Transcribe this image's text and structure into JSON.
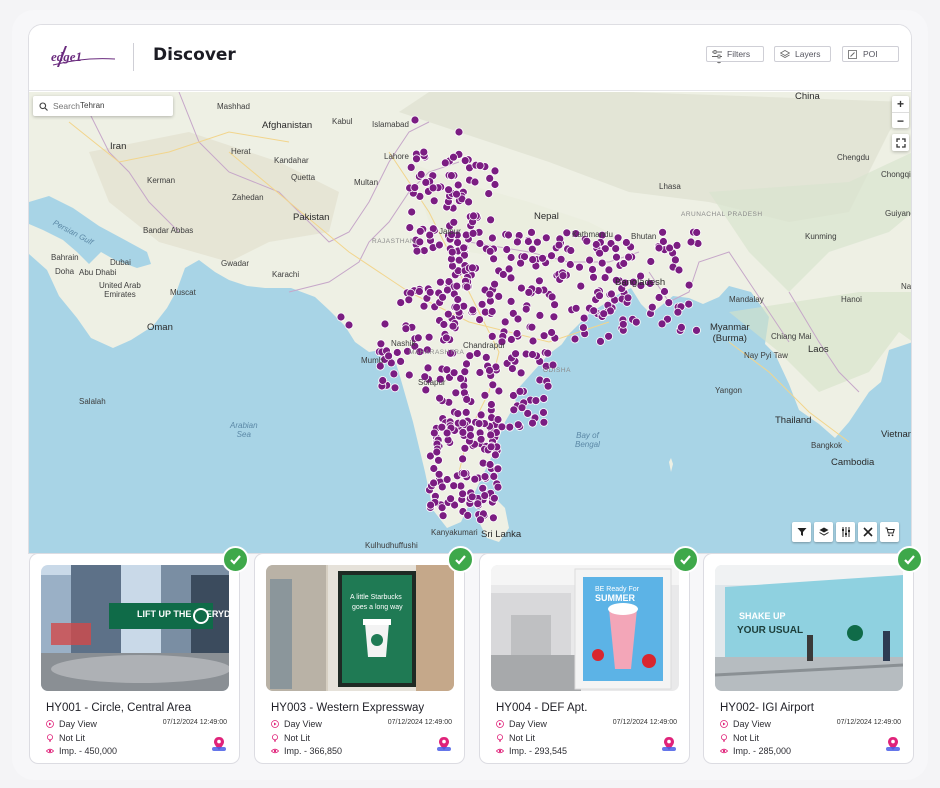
{
  "header": {
    "logo_text": "edge1",
    "title": "Discover",
    "buttons": [
      {
        "label": "Filters",
        "icon": "sliders-icon"
      },
      {
        "label": "Layers",
        "icon": "layers-icon"
      },
      {
        "label": "POI",
        "icon": "pencil-icon"
      }
    ]
  },
  "map": {
    "search_placeholder": "Search",
    "zoom_in": "+",
    "zoom_out": "−",
    "labels": {
      "china": "China",
      "afghanistan": "Afghanistan",
      "kabul": "Kabul",
      "islamabad": "Islamabad",
      "iran": "Iran",
      "tehran": "Tehran",
      "mashhad": "Mashhad",
      "herat": "Herat",
      "kandahar": "Kandahar",
      "quetta": "Quetta",
      "kerman": "Kerman",
      "zahedan": "Zahedan",
      "lahore": "Lahore",
      "multan": "Multan",
      "pakistan": "Pakistan",
      "karachi": "Karachi",
      "gwadar": "Gwadar",
      "jaipur": "Jaipur",
      "rajasthan": "RAJASTHAN",
      "nepal": "Nepal",
      "kathmandu": "Kathmandu",
      "bhutan": "Bhutan",
      "lhasa": "Lhasa",
      "arunachal": "ARUNACHAL PRADESH",
      "bangladesh": "Bangladesh",
      "myanmar": "Myanmar\n(Burma)",
      "laos": "Laos",
      "thailand": "Thailand",
      "bangkok": "Bangkok",
      "vietnam": "Vietnam",
      "cambodia": "Cambodia",
      "hanoi": "Hanoi",
      "nanning": "Nanning",
      "kunming": "Kunming",
      "guiyang": "Guiyang",
      "chongqing": "Chongqing",
      "chengdu": "Chengdu",
      "mandalay": "Mandalay",
      "yangon": "Yangon",
      "nay_pyi_taw": "Nay Pyi Taw",
      "oman": "Oman",
      "muscat": "Muscat",
      "dubai": "Dubai",
      "abu_dhabi": "Abu Dhabi",
      "uae": "United Arab\nEmirates",
      "bahrain": "Bahrain",
      "doha": "Doha",
      "salalah": "Salalah",
      "persian_gulf": "Persian Gulf",
      "arabian_sea": "Arabian\nSea",
      "bay_of_bengal": "Bay of\nBengal",
      "sri_lanka": "Sri Lanka",
      "maharashtra": "MAHARASHTRA",
      "odisha": "ODISHA",
      "chandrapur": "Chandrapur",
      "solapur": "Solapur",
      "nashik": "Nashik",
      "mumbai": "Mumb",
      "kulhudhuffushi": "Kulhudhuffushi",
      "kanyakumari": "Kanyakumari",
      "chiang_mai": "Chiang Mai",
      "bandar_abbas": "Bandar Abbas"
    }
  },
  "cards": [
    {
      "title": "HY001 - Circle, Central Area",
      "view": "Day View",
      "date": "07/12/2024 12:49:00",
      "lit": "Not Lit",
      "impressions": "Imp. - 450,000"
    },
    {
      "title": "HY003 - Western Expressway",
      "view": "Day View",
      "date": "07/12/2024 12:49:00",
      "lit": "Not Lit",
      "impressions": "Imp. - 366,850"
    },
    {
      "title": "HY004 - DEF Apt.",
      "view": "Day View",
      "date": "07/12/2024 12:49:00",
      "lit": "Not Lit",
      "impressions": "Imp. - 293,545"
    },
    {
      "title": "HY002- IGI Airport",
      "view": "Day View",
      "date": "07/12/2024 12:49:00",
      "lit": "Not Lit",
      "impressions": "Imp. - 285,000"
    }
  ],
  "ad_texts": {
    "card1": "LIFT UP THE EVERYDAY",
    "card2_line1": "A little Starbucks",
    "card2_line2": "goes a long way",
    "card3_line1": "BE Ready For",
    "card3_line2": "SUMMER",
    "card4_line1": "SHAKE UP",
    "card4_line2": "YOUR USUAL"
  },
  "colors": {
    "marker": "#7b1d82",
    "check": "#3ea84a",
    "accent_pink": "#e0237a",
    "land": "#eef0e4",
    "water": "#a8d4e6"
  }
}
